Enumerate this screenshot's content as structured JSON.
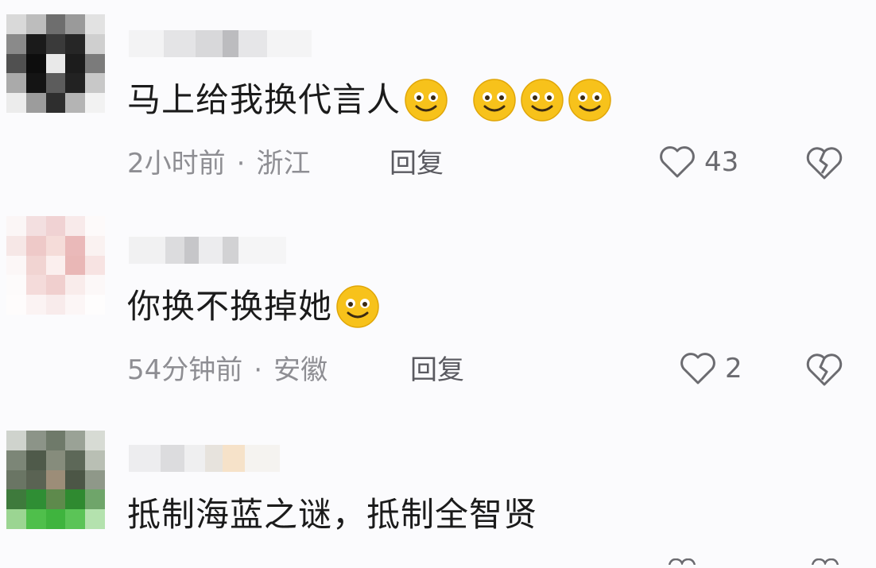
{
  "comments": [
    {
      "text": "马上给我换代言人",
      "emoji_count_adjacent": 1,
      "emoji_count_group": 3,
      "time": "2小时前",
      "separator": "·",
      "location": "浙江",
      "reply_label": "回复",
      "like_count": "43"
    },
    {
      "text": "你换不换掉她",
      "emoji_count_adjacent": 1,
      "time": "54分钟前",
      "separator": "·",
      "location": "安徽",
      "reply_label": "回复",
      "like_count": "2"
    },
    {
      "text": "抵制海蓝之谜，抵制全智贤"
    }
  ],
  "icons": {
    "like": "heart-outline-icon",
    "dislike": "broken-heart-icon",
    "emoji": "smiling-face-emoji"
  },
  "colors": {
    "background": "#fbfbfd",
    "text": "#1b1b1b",
    "meta": "#8e8e93",
    "emoji_yellow": "#f7c21b"
  }
}
